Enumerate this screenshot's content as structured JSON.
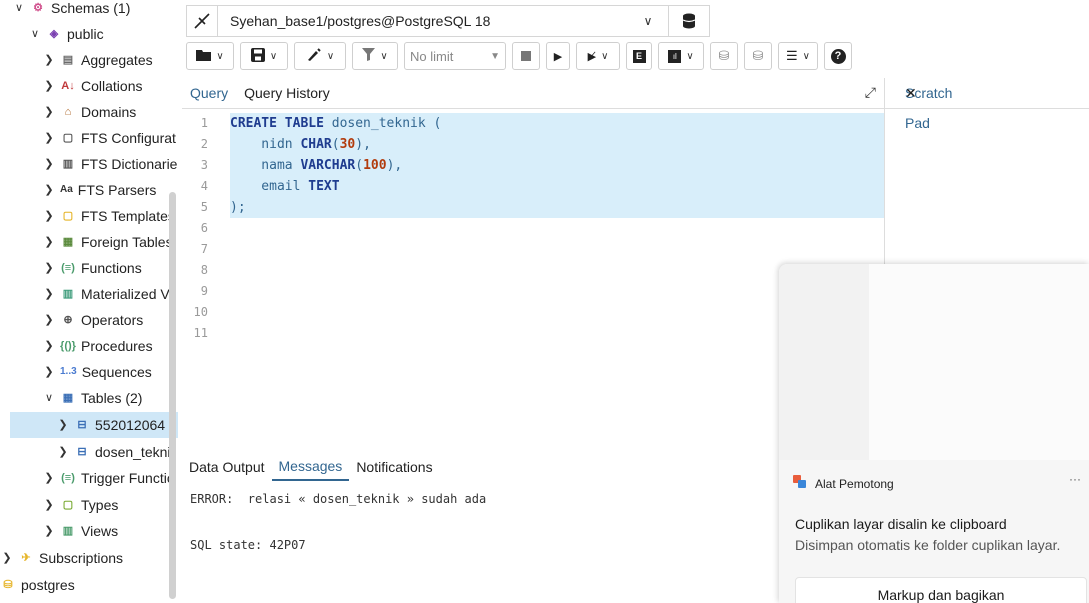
{
  "sidebar": {
    "items": [
      {
        "label": "Schemas (1)",
        "chevron": "v"
      },
      {
        "label": "public",
        "chevron": "v"
      },
      {
        "label": "Aggregates",
        "chevron": ">"
      },
      {
        "label": "Collations",
        "chevron": ">"
      },
      {
        "label": "Domains",
        "chevron": ">"
      },
      {
        "label": "FTS Configurat",
        "chevron": ">"
      },
      {
        "label": "FTS Dictionarie",
        "chevron": ">"
      },
      {
        "label": "FTS Parsers",
        "chevron": ">",
        "icon_text": "Aa"
      },
      {
        "label": "FTS Templates",
        "chevron": ">"
      },
      {
        "label": "Foreign Tables",
        "chevron": ">"
      },
      {
        "label": "Functions",
        "chevron": ">"
      },
      {
        "label": "Materialized Vi",
        "chevron": ">"
      },
      {
        "label": "Operators",
        "chevron": ">"
      },
      {
        "label": "Procedures",
        "chevron": ">"
      },
      {
        "label": "Sequences",
        "chevron": ">",
        "icon_text": "1..3"
      },
      {
        "label": "Tables (2)",
        "chevron": "v"
      },
      {
        "label": "552012064",
        "chevron": ">"
      },
      {
        "label": "dosen_teknil",
        "chevron": ">"
      },
      {
        "label": "Trigger Functio",
        "chevron": ">"
      },
      {
        "label": "Types",
        "chevron": ">"
      },
      {
        "label": "Views",
        "chevron": ">"
      },
      {
        "label": "Subscriptions",
        "chevron": ">"
      },
      {
        "label": "postgres",
        "chevron": ""
      }
    ]
  },
  "connection": {
    "label": "Syehan_base1/postgres@PostgreSQL 18"
  },
  "toolbar": {
    "limit_label": "No limit"
  },
  "query_tabs": {
    "query": "Query",
    "history": "Query History"
  },
  "editor": {
    "line_numbers": [
      "1",
      "2",
      "3",
      "4",
      "5",
      "6",
      "7",
      "8",
      "9",
      "10",
      "11"
    ],
    "lines": [
      [
        {
          "t": "CREATE TABLE",
          "k": "kw"
        },
        {
          "t": " dosen_teknik (",
          "k": ""
        }
      ],
      [
        {
          "t": "    nidn ",
          "k": ""
        },
        {
          "t": "CHAR",
          "k": "kw"
        },
        {
          "t": "(",
          "k": ""
        },
        {
          "t": "30",
          "k": "num"
        },
        {
          "t": "),",
          "k": ""
        }
      ],
      [
        {
          "t": "    nama ",
          "k": ""
        },
        {
          "t": "VARCHAR",
          "k": "kw"
        },
        {
          "t": "(",
          "k": ""
        },
        {
          "t": "100",
          "k": "num"
        },
        {
          "t": "),",
          "k": ""
        }
      ],
      [
        {
          "t": "    email ",
          "k": ""
        },
        {
          "t": "TEXT",
          "k": "kw"
        }
      ],
      [
        {
          "t": ");",
          "k": ""
        }
      ],
      [],
      [],
      [],
      [],
      [],
      []
    ]
  },
  "scratch_pad": {
    "title": "Scratch Pad",
    "close": "✕"
  },
  "output_tabs": {
    "data_output": "Data Output",
    "messages": "Messages",
    "notifications": "Notifications"
  },
  "messages": {
    "error": "ERROR:  relasi « dosen_teknik » sudah ada",
    "sql_state": "SQL state: 42P07"
  },
  "notification": {
    "app": "Alat Pemotong",
    "more": "···",
    "title": "Cuplikan layar disalin ke clipboard",
    "body": "Disimpan otomatis ke folder cuplikan layar.",
    "action": "Markup dan bagikan"
  }
}
